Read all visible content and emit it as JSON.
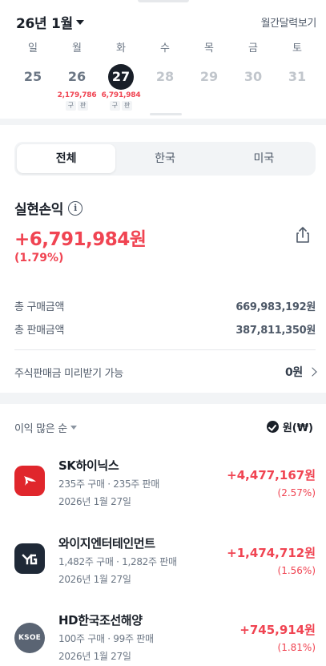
{
  "header": {
    "month_label": "26년 1월",
    "monthly_link": "월간달력보기"
  },
  "week": {
    "days": [
      {
        "dow": "일",
        "num": "25",
        "amount": "",
        "tags": []
      },
      {
        "dow": "월",
        "num": "26",
        "amount": "2,179,786",
        "tags": [
          "구",
          "판"
        ]
      },
      {
        "dow": "화",
        "num": "27",
        "amount": "6,791,984",
        "tags": [
          "구",
          "판"
        ]
      },
      {
        "dow": "수",
        "num": "28",
        "amount": "",
        "tags": []
      },
      {
        "dow": "목",
        "num": "29",
        "amount": "",
        "tags": []
      },
      {
        "dow": "금",
        "num": "30",
        "amount": "",
        "tags": []
      },
      {
        "dow": "토",
        "num": "31",
        "amount": "",
        "tags": []
      }
    ],
    "selected_index": 2
  },
  "tabs": [
    "전체",
    "한국",
    "미국"
  ],
  "summary": {
    "title": "실현손익",
    "info_icon": "info-icon",
    "total": "+6,791,984원",
    "rate": "(1.79%)",
    "rows": [
      {
        "label": "총 구매금액",
        "value": "669,983,192원"
      },
      {
        "label": "총 판매금액",
        "value": "387,811,350원"
      }
    ],
    "advance_label": "주식판매금 미리받기 가능",
    "advance_value": "0원"
  },
  "list": {
    "sort_label": "이익 많은 순",
    "currency_label": "원(₩)",
    "items": [
      {
        "logo": "sk-hynix-logo",
        "name": "SK하이닉스",
        "qty": "235주 구매 · 235주 판매",
        "date": "2026년 1월 27일",
        "gain": "+4,477,167원",
        "pct": "(2.57%)"
      },
      {
        "logo": "yg-logo",
        "name": "와이지엔터테인먼트",
        "qty": "1,482주 구매 · 1,282주 판매",
        "date": "2026년 1월 27일",
        "gain": "+1,474,712원",
        "pct": "(1.56%)"
      },
      {
        "logo": "ksoe-logo",
        "logo_text": "KSOE",
        "name": "HD한국조선해양",
        "qty": "100주 구매 · 99주 판매",
        "date": "2026년 1월 27일",
        "gain": "+745,914원",
        "pct": "(1.81%)"
      }
    ]
  },
  "colors": {
    "profit": "#f04452",
    "text": "#191f28",
    "muted": "#6b7684"
  }
}
